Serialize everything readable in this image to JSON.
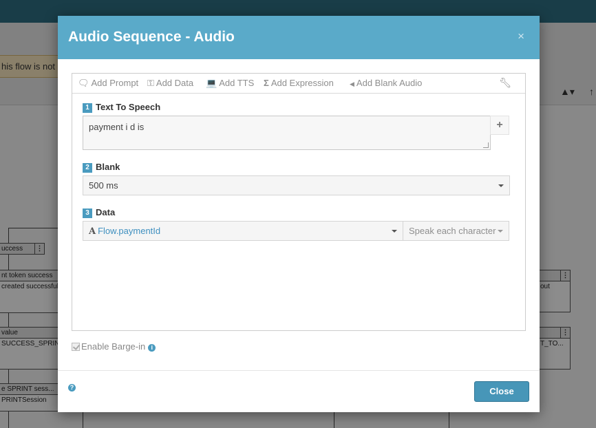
{
  "background": {
    "warning_text": "his flow is not c",
    "nodes": [
      {
        "header": "uccess",
        "body": ""
      },
      {
        "header": "nt token success",
        "body": "created successful"
      },
      {
        "header": "value",
        "body": "SUCCESS_SPRIN"
      },
      {
        "header": "e SPRINT sess...",
        "body": "PRINTSession"
      },
      {
        "header": "",
        "body": "out"
      },
      {
        "header": "",
        "body": "T_TO..."
      }
    ]
  },
  "dialog": {
    "title": "Audio Sequence - Audio",
    "close_x": "×",
    "toolbar": {
      "add_prompt": "Add Prompt",
      "add_data": "Add Data",
      "add_tts": "Add TTS",
      "add_expression": "Add Expression",
      "add_blank_audio": "Add Blank Audio"
    },
    "segments": [
      {
        "number": "1",
        "label": "Text To Speech",
        "value": "payment i d is",
        "plus": "+"
      },
      {
        "number": "2",
        "label": "Blank",
        "value": "500 ms"
      },
      {
        "number": "3",
        "label": "Data",
        "value": "Flow.paymentId",
        "format": "Speak each character"
      }
    ],
    "barge_in_label": "Enable Barge-in",
    "close_button": "Close",
    "help": "?",
    "info": "i"
  },
  "colors": {
    "header": "#5aaac9",
    "accent": "#4a9bbf",
    "close_button": "#4796b8"
  }
}
